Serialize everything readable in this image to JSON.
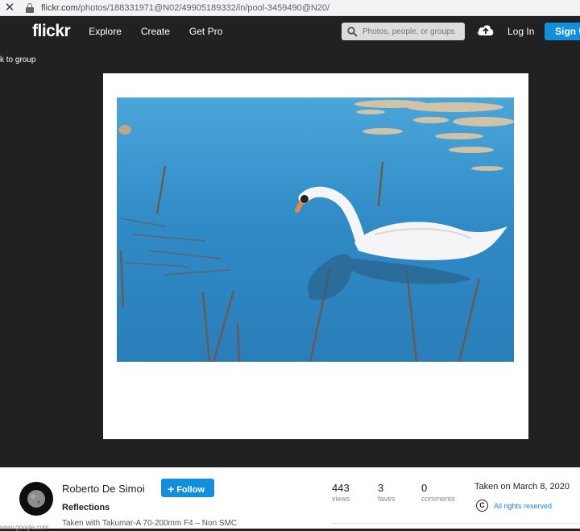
{
  "browser": {
    "close_glyph": "✕",
    "url_host": "flickr.com",
    "url_path": "/photos/188331971@N02/49905189332/in/pool-3459490@N20/"
  },
  "nav": {
    "logo": "flickr",
    "explore": "Explore",
    "create": "Create",
    "get_pro": "Get Pro",
    "search_placeholder": "Photos, people, or groups",
    "login": "Log In",
    "signup": "Sign Up"
  },
  "back_link": "k to group",
  "photo": {
    "author": "Roberto De Simoi",
    "follow_label": "Follow",
    "title": "Reflections",
    "description": "Taken with Takumar-A 70-200mm F4 – Non SMC"
  },
  "stats": [
    {
      "value": "443",
      "label": "views"
    },
    {
      "value": "3",
      "label": "faves"
    },
    {
      "value": "0",
      "label": "comments"
    }
  ],
  "taken_on": "Taken on March 8, 2020",
  "rights": {
    "cc_glyph": "C",
    "label": "All rights reserved"
  },
  "partial_bottom_text": "www.google.com",
  "icons": {
    "search": "search-icon",
    "upload": "cloud-upload-icon",
    "lock": "lock-icon"
  },
  "colors": {
    "accent": "#128fdc",
    "nav_bg": "#212124",
    "page_bg": "#212124"
  }
}
